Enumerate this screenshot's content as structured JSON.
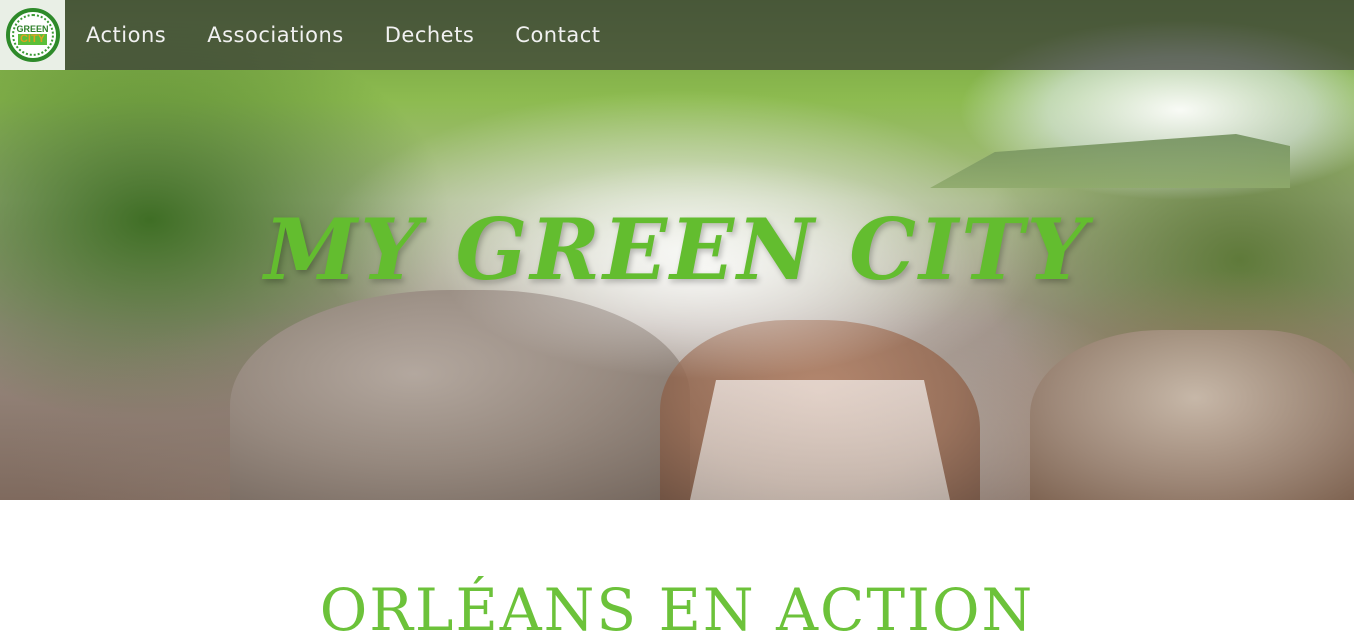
{
  "navbar": {
    "logo": {
      "line1": "GREEN",
      "line2": "CITY"
    },
    "links": [
      {
        "label": "Actions"
      },
      {
        "label": "Associations"
      },
      {
        "label": "Dechets"
      },
      {
        "label": "Contact"
      }
    ]
  },
  "hero": {
    "title": "MY GREEN CITY"
  },
  "section": {
    "title": "ORLÉANS EN ACTION"
  },
  "colors": {
    "accent_green": "#63bd2f",
    "navbar_overlay": "rgba(55,55,55,0.68)"
  }
}
